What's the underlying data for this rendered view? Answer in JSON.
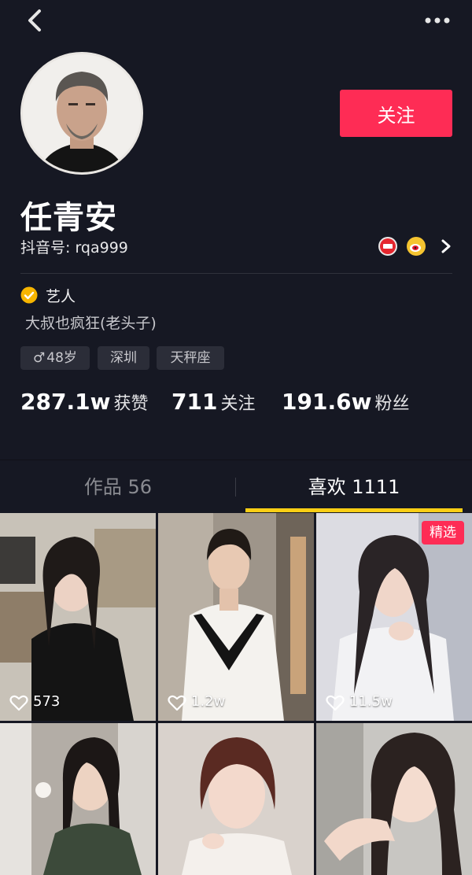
{
  "profile": {
    "name": "任青安",
    "douyin_id": "抖音号: rqa999",
    "follow_label": "关注",
    "verified_label": "艺人",
    "bio": "大叔也疯狂(老头子)",
    "tags": {
      "gender_age": "48岁",
      "city": "深圳",
      "zodiac": "天秤座"
    },
    "gender_icon": "♂",
    "share_icons": [
      "toutiao-icon",
      "weibo-icon",
      "chevron-right-icon"
    ]
  },
  "stats": {
    "likes": {
      "value": "287.1w",
      "label": "获赞"
    },
    "following": {
      "value": "711",
      "label": "关注"
    },
    "followers": {
      "value": "191.6w",
      "label": "粉丝"
    }
  },
  "tabs": {
    "works": "作品 56",
    "likes": "喜欢 1111",
    "active": "likes"
  },
  "videos": [
    {
      "likes": "573",
      "featured": false
    },
    {
      "likes": "1.2w",
      "featured": false
    },
    {
      "likes": "11.5w",
      "featured": true,
      "badge": "精选"
    },
    {
      "likes": "",
      "featured": false
    },
    {
      "likes": "",
      "featured": false
    },
    {
      "likes": "",
      "featured": false
    }
  ],
  "colors": {
    "background": "#161823",
    "accent": "#fe2c55",
    "tab_indicator": "#face15",
    "verified": "#f7b500"
  }
}
